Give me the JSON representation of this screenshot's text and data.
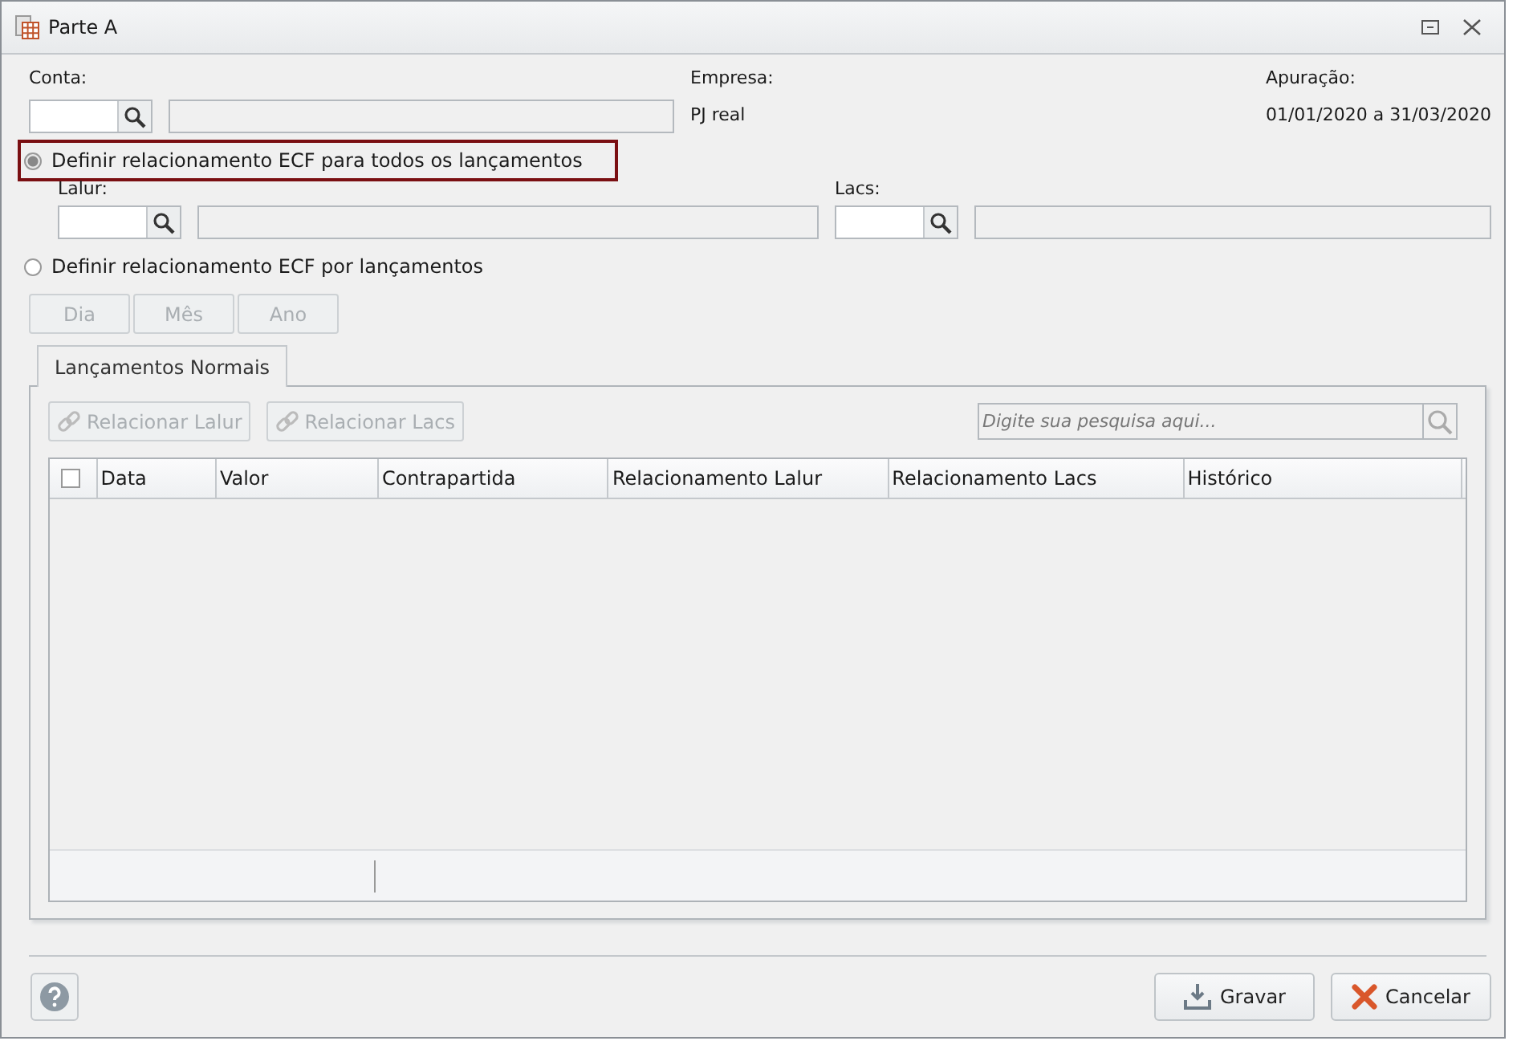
{
  "window": {
    "title": "Parte A"
  },
  "conta": {
    "label": "Conta:"
  },
  "empresa": {
    "label": "Empresa:",
    "value": "PJ real"
  },
  "apuracao": {
    "label": "Apuração:",
    "value": "01/01/2020 a 31/03/2020"
  },
  "options": [
    {
      "label": "Definir relacionamento ECF para todos os lançamentos",
      "selected": true,
      "focused": true
    },
    {
      "label": "Definir relacionamento ECF por lançamentos",
      "selected": false,
      "focused": false
    }
  ],
  "lalur": {
    "label": "Lalur:"
  },
  "lacs": {
    "label": "Lacs:"
  },
  "period_buttons": [
    {
      "label": "Dia",
      "disabled": true
    },
    {
      "label": "Mês",
      "disabled": true
    },
    {
      "label": "Ano",
      "disabled": true
    }
  ],
  "tabs": [
    {
      "label": "Lançamentos Normais",
      "selected": true
    }
  ],
  "actions": [
    {
      "label": "Relacionar Lalur",
      "disabled": true
    },
    {
      "label": "Relacionar Lacs",
      "disabled": true
    }
  ],
  "search": {
    "placeholder": "Digite sua pesquisa aqui..."
  },
  "table": {
    "select_all_checked": false,
    "columns": [
      "Data",
      "Valor",
      "Contrapartida",
      "Relacionamento Lalur",
      "Relacionamento Lacs",
      "Histórico"
    ]
  },
  "footer_buttons": [
    {
      "kind": "save",
      "label": "Gravar"
    },
    {
      "kind": "cancel",
      "label": "Cancelar"
    }
  ]
}
